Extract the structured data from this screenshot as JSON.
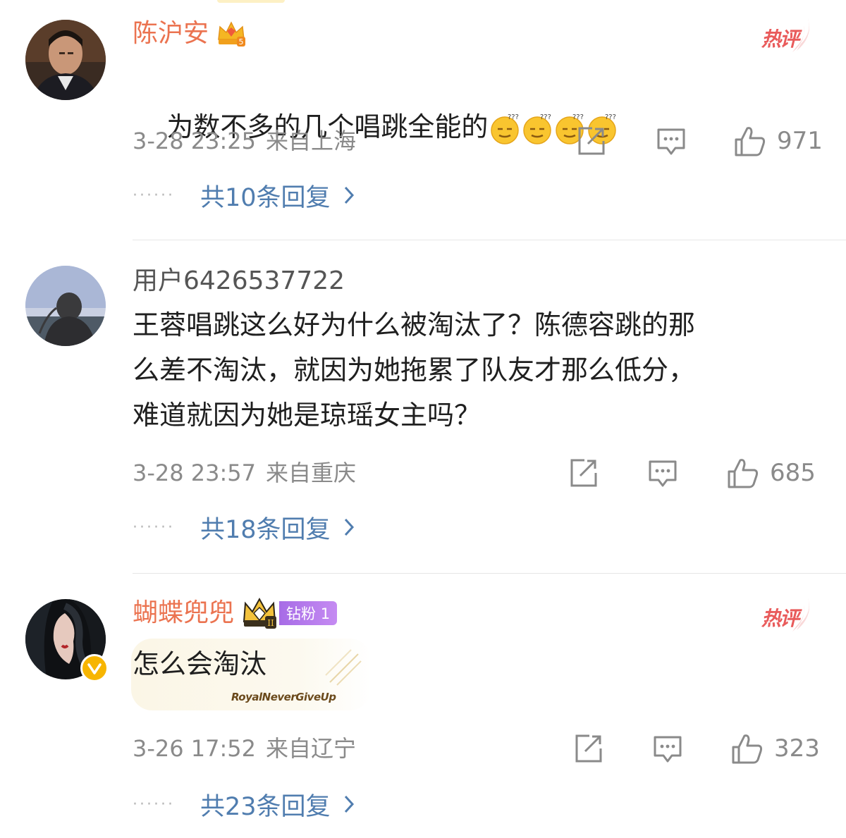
{
  "comments": [
    {
      "username": "陈沪安",
      "text": "为数不多的几个唱跳全能的",
      "emoji_name": "dizzy-face-emoji",
      "emoji_count": 4,
      "date": "3-28 23:25",
      "location": "来自上海",
      "likes": "971",
      "replies": "共10条回复",
      "hot_tag": "热评",
      "vip_level": "5"
    },
    {
      "username": "用户6426537722",
      "text": "王蓉唱跳这么好为什么被淘汰了？陈德容跳的那\n么差不淘汰，就因为她拖累了队友才那么低分，\n难道就因为她是琼瑶女主吗？",
      "date": "3-28 23:57",
      "location": "来自重庆",
      "likes": "685",
      "replies": "共18条回复"
    },
    {
      "username": "蝴蝶兜兜",
      "text": "怎么会淘汰",
      "fan_badge": "钻粉 1",
      "crown_level": "II",
      "bubble_stamp": "RoyalNeverGiveUp",
      "date": "3-26 17:52",
      "location": "来自辽宁",
      "likes": "323",
      "replies": "共23条回复",
      "hot_tag": "热评"
    }
  ],
  "colors": {
    "vip_name": "#eb7350",
    "reply_link": "#507daf",
    "meta_text": "#8a8a8a",
    "hot_tag": "#e95b5b"
  },
  "icons": {
    "repost": "repost-icon",
    "comment": "comment-icon",
    "like": "thumbs-up-icon",
    "chevron": "chevron-right-icon"
  }
}
